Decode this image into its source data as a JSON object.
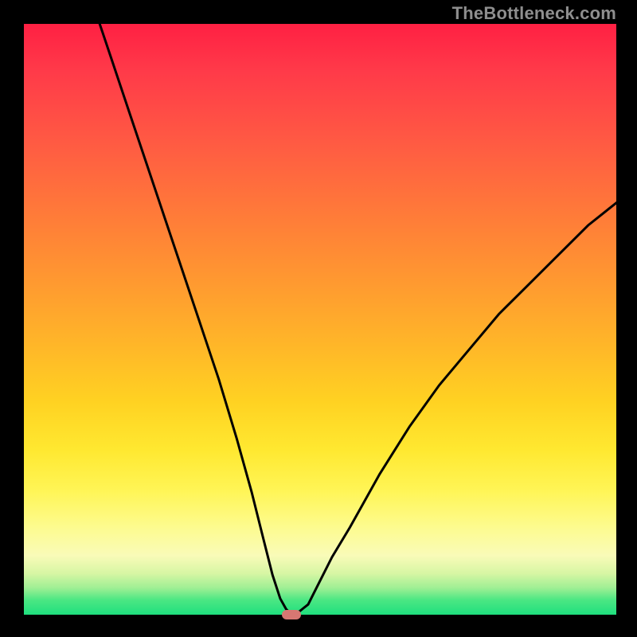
{
  "watermark": "TheBottleneck.com",
  "chart_data": {
    "type": "line",
    "title": "",
    "xlabel": "",
    "ylabel": "",
    "xlim": [
      0,
      100
    ],
    "ylim": [
      0,
      100
    ],
    "grid": false,
    "legend": false,
    "background": {
      "type": "vertical-gradient",
      "stops": [
        {
          "pos": 0,
          "color": "#ff2043"
        },
        {
          "pos": 20,
          "color": "#ff5a43"
        },
        {
          "pos": 44,
          "color": "#ff9a30"
        },
        {
          "pos": 64,
          "color": "#ffd222"
        },
        {
          "pos": 85,
          "color": "#fdfb8d"
        },
        {
          "pos": 100,
          "color": "#1fdf7e"
        }
      ]
    },
    "series": [
      {
        "name": "bottleneck-curve",
        "color": "#000000",
        "x": [
          13,
          15,
          18,
          21,
          24,
          27,
          30,
          33,
          36,
          38.5,
          40.5,
          42,
          43.3,
          44.3,
          45.0,
          45.5,
          46.0,
          48.0,
          49.0,
          52,
          55,
          60,
          65,
          70,
          75,
          80,
          85,
          90,
          95,
          100
        ],
        "y": [
          100,
          94,
          85,
          76,
          67,
          58,
          49,
          40,
          30,
          21,
          13,
          7,
          3,
          1.2,
          0.5,
          0.3,
          0.4,
          2,
          4,
          10,
          15,
          24,
          32,
          39,
          45,
          51,
          56,
          61,
          66,
          70
        ]
      }
    ],
    "marker": {
      "name": "optimal-point",
      "x": 45.2,
      "y": 0.3,
      "color": "#d77772"
    }
  }
}
